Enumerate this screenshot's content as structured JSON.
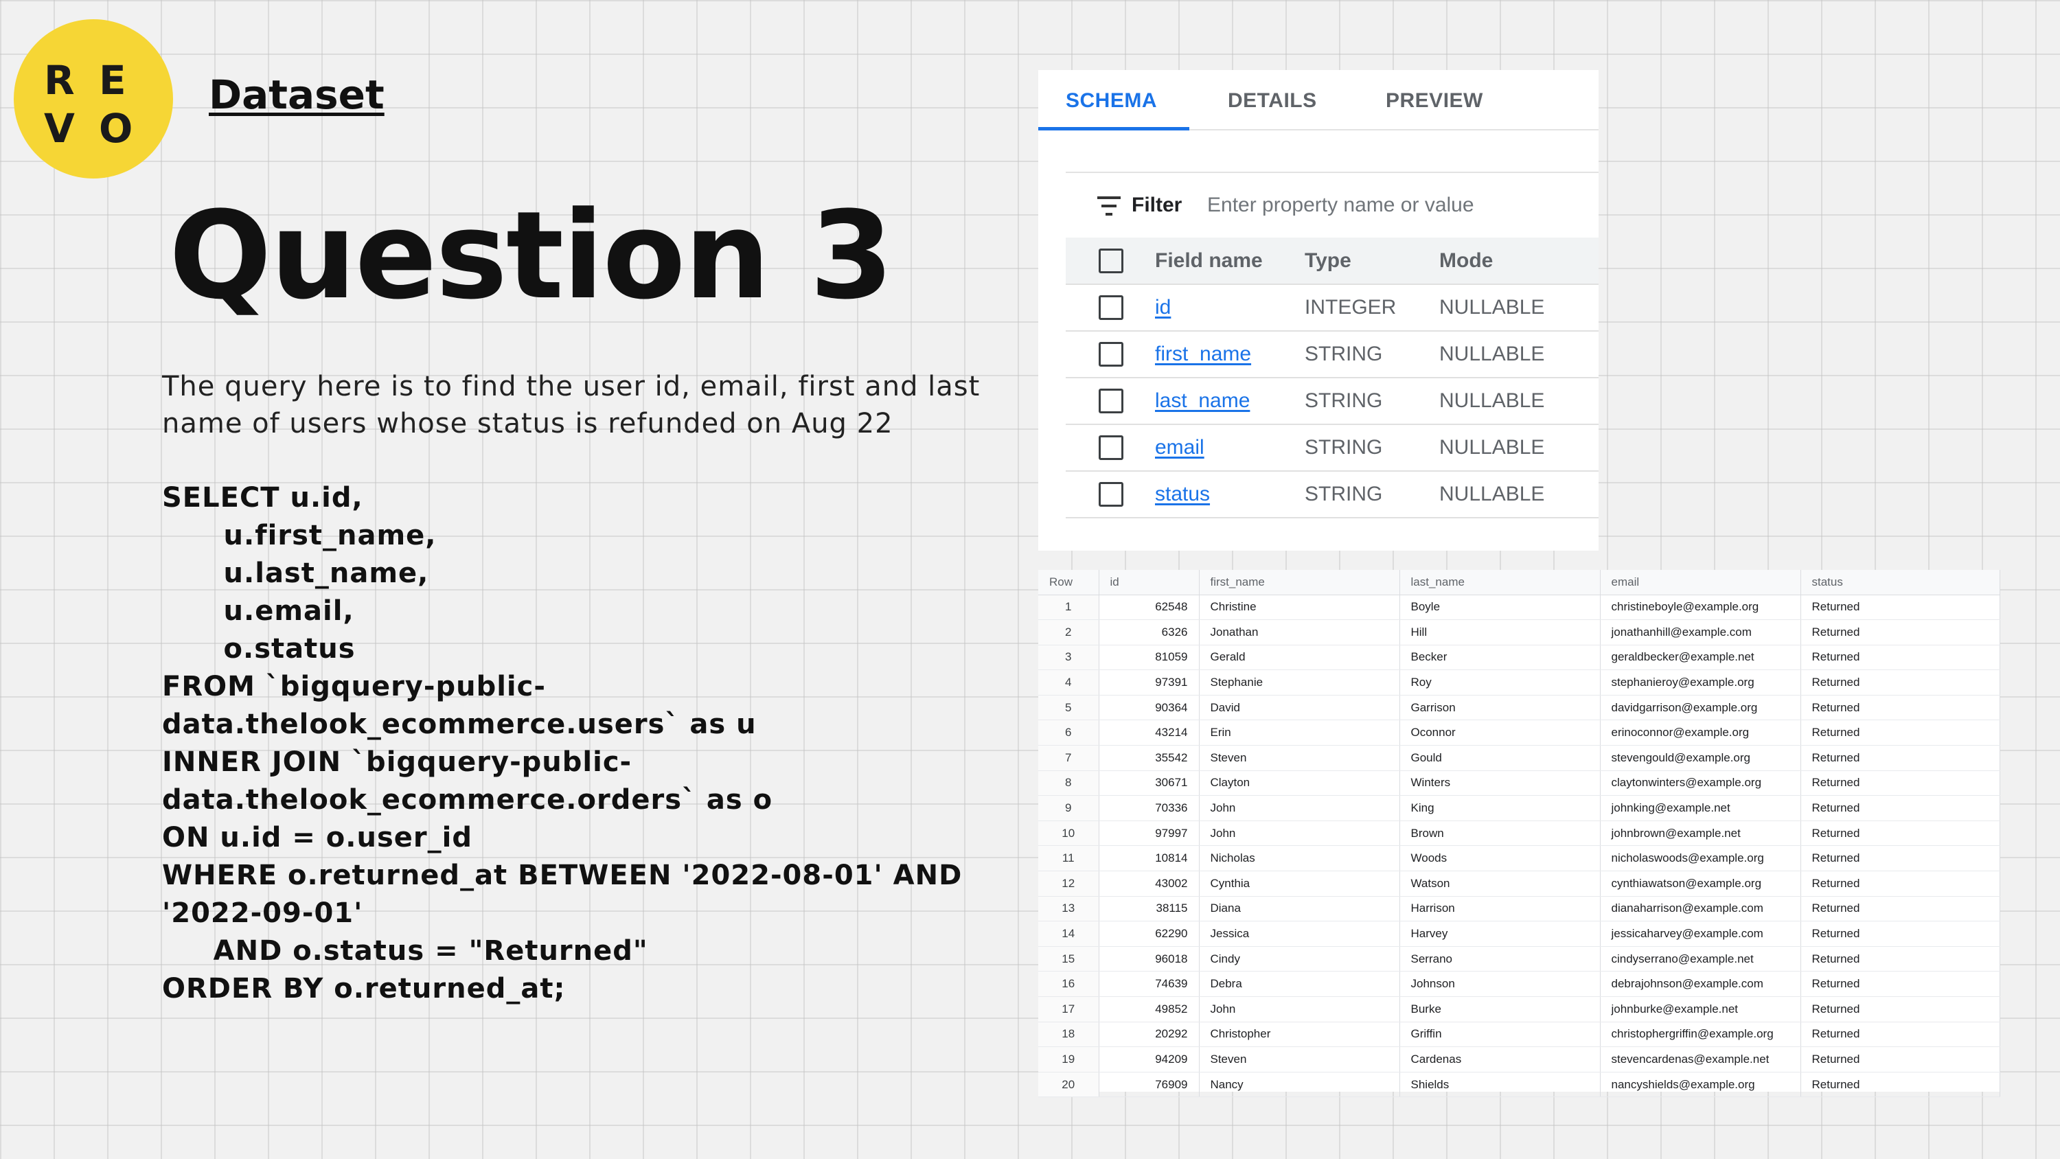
{
  "logo": {
    "letters": [
      "R",
      "E",
      "V",
      "O"
    ]
  },
  "section_label": "Dataset",
  "title": "Question 3",
  "description": "The query here is to find the user id, email, first and last name of users whose status is refunded on Aug 22",
  "sql_lines": [
    "SELECT u.id,",
    "      u.first_name,",
    "      u.last_name,",
    "      u.email,",
    "      o.status",
    "FROM `bigquery-public-",
    "data.thelook_ecommerce.users` as u",
    "INNER JOIN `bigquery-public-",
    "data.thelook_ecommerce.orders` as o",
    "ON u.id = o.user_id",
    "WHERE o.returned_at BETWEEN '2022-08-01' AND",
    "'2022-09-01'",
    "     AND o.status = \"Returned\"",
    "ORDER BY o.returned_at;"
  ],
  "schema_panel": {
    "tabs": [
      "SCHEMA",
      "DETAILS",
      "PREVIEW"
    ],
    "active_tab": "SCHEMA",
    "filter_label": "Filter",
    "filter_placeholder": "Enter property name or value",
    "columns": [
      "Field name",
      "Type",
      "Mode"
    ],
    "fields": [
      {
        "name": "id",
        "type": "INTEGER",
        "mode": "NULLABLE"
      },
      {
        "name": "first_name",
        "type": "STRING",
        "mode": "NULLABLE"
      },
      {
        "name": "last_name",
        "type": "STRING",
        "mode": "NULLABLE"
      },
      {
        "name": "email",
        "type": "STRING",
        "mode": "NULLABLE"
      },
      {
        "name": "status",
        "type": "STRING",
        "mode": "NULLABLE"
      }
    ]
  },
  "results_table": {
    "columns": [
      "Row",
      "id",
      "first_name",
      "last_name",
      "email",
      "status"
    ],
    "rows": [
      [
        "1",
        "62548",
        "Christine",
        "Boyle",
        "christineboyle@example.org",
        "Returned"
      ],
      [
        "2",
        "6326",
        "Jonathan",
        "Hill",
        "jonathanhill@example.com",
        "Returned"
      ],
      [
        "3",
        "81059",
        "Gerald",
        "Becker",
        "geraldbecker@example.net",
        "Returned"
      ],
      [
        "4",
        "97391",
        "Stephanie",
        "Roy",
        "stephanieroy@example.org",
        "Returned"
      ],
      [
        "5",
        "90364",
        "David",
        "Garrison",
        "davidgarrison@example.org",
        "Returned"
      ],
      [
        "6",
        "43214",
        "Erin",
        "Oconnor",
        "erinoconnor@example.org",
        "Returned"
      ],
      [
        "7",
        "35542",
        "Steven",
        "Gould",
        "stevengould@example.org",
        "Returned"
      ],
      [
        "8",
        "30671",
        "Clayton",
        "Winters",
        "claytonwinters@example.org",
        "Returned"
      ],
      [
        "9",
        "70336",
        "John",
        "King",
        "johnking@example.net",
        "Returned"
      ],
      [
        "10",
        "97997",
        "John",
        "Brown",
        "johnbrown@example.net",
        "Returned"
      ],
      [
        "11",
        "10814",
        "Nicholas",
        "Woods",
        "nicholaswoods@example.org",
        "Returned"
      ],
      [
        "12",
        "43002",
        "Cynthia",
        "Watson",
        "cynthiawatson@example.org",
        "Returned"
      ],
      [
        "13",
        "38115",
        "Diana",
        "Harrison",
        "dianaharrison@example.com",
        "Returned"
      ],
      [
        "14",
        "62290",
        "Jessica",
        "Harvey",
        "jessicaharvey@example.com",
        "Returned"
      ],
      [
        "15",
        "96018",
        "Cindy",
        "Serrano",
        "cindyserrano@example.net",
        "Returned"
      ],
      [
        "16",
        "74639",
        "Debra",
        "Johnson",
        "debrajohnson@example.com",
        "Returned"
      ],
      [
        "17",
        "49852",
        "John",
        "Burke",
        "johnburke@example.net",
        "Returned"
      ],
      [
        "18",
        "20292",
        "Christopher",
        "Griffin",
        "christophergriffin@example.org",
        "Returned"
      ],
      [
        "19",
        "94209",
        "Steven",
        "Cardenas",
        "stevencardenas@example.net",
        "Returned"
      ],
      [
        "20",
        "76909",
        "Nancy",
        "Shields",
        "nancyshields@example.org",
        "Returned"
      ]
    ]
  },
  "colors": {
    "logo_yellow": "#f6d635",
    "accent_blue": "#1a73e8",
    "background": "#f1f1f1"
  }
}
